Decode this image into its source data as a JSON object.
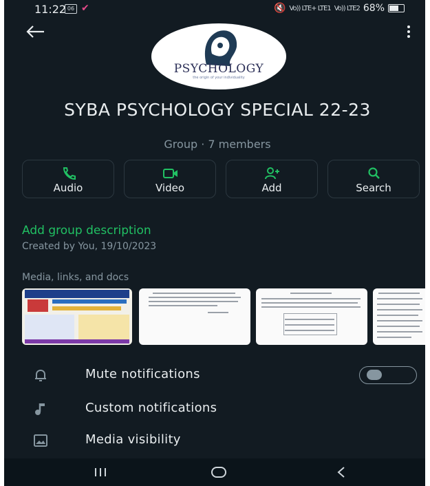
{
  "status_bar": {
    "time": "11:22",
    "notif_icon_text": "06",
    "network_1": "Vo)) LTE+ LTE1",
    "network_2": "Vo)) LTE2",
    "battery": "68%"
  },
  "header": {
    "back_icon": "arrow-left-icon",
    "menu_icon": "more-vert-icon"
  },
  "group": {
    "avatar_brand": "PSYCHOLOGY",
    "avatar_tagline": "the origin of your individuality",
    "name": "SYBA PSYCHOLOGY SPECIAL 22-23",
    "meta": "Group · 7 members"
  },
  "actions": [
    {
      "label": "Audio",
      "icon": "phone-icon"
    },
    {
      "label": "Video",
      "icon": "video-icon"
    },
    {
      "label": "Add",
      "icon": "add-person-icon"
    },
    {
      "label": "Search",
      "icon": "search-icon"
    }
  ],
  "description": {
    "add_label": "Add group description",
    "created": "Created by You, 19/10/2023"
  },
  "media": {
    "title": "Media, links, and docs"
  },
  "settings": [
    {
      "label": "Mute notifications",
      "icon": "bell-icon",
      "toggle_on": false
    },
    {
      "label": "Custom notifications",
      "icon": "music-note-icon"
    },
    {
      "label": "Media visibility",
      "icon": "image-icon"
    }
  ],
  "colors": {
    "background": "#121b22",
    "accent": "#21c063",
    "text_primary": "#e9edef",
    "text_secondary": "#8696a0"
  }
}
